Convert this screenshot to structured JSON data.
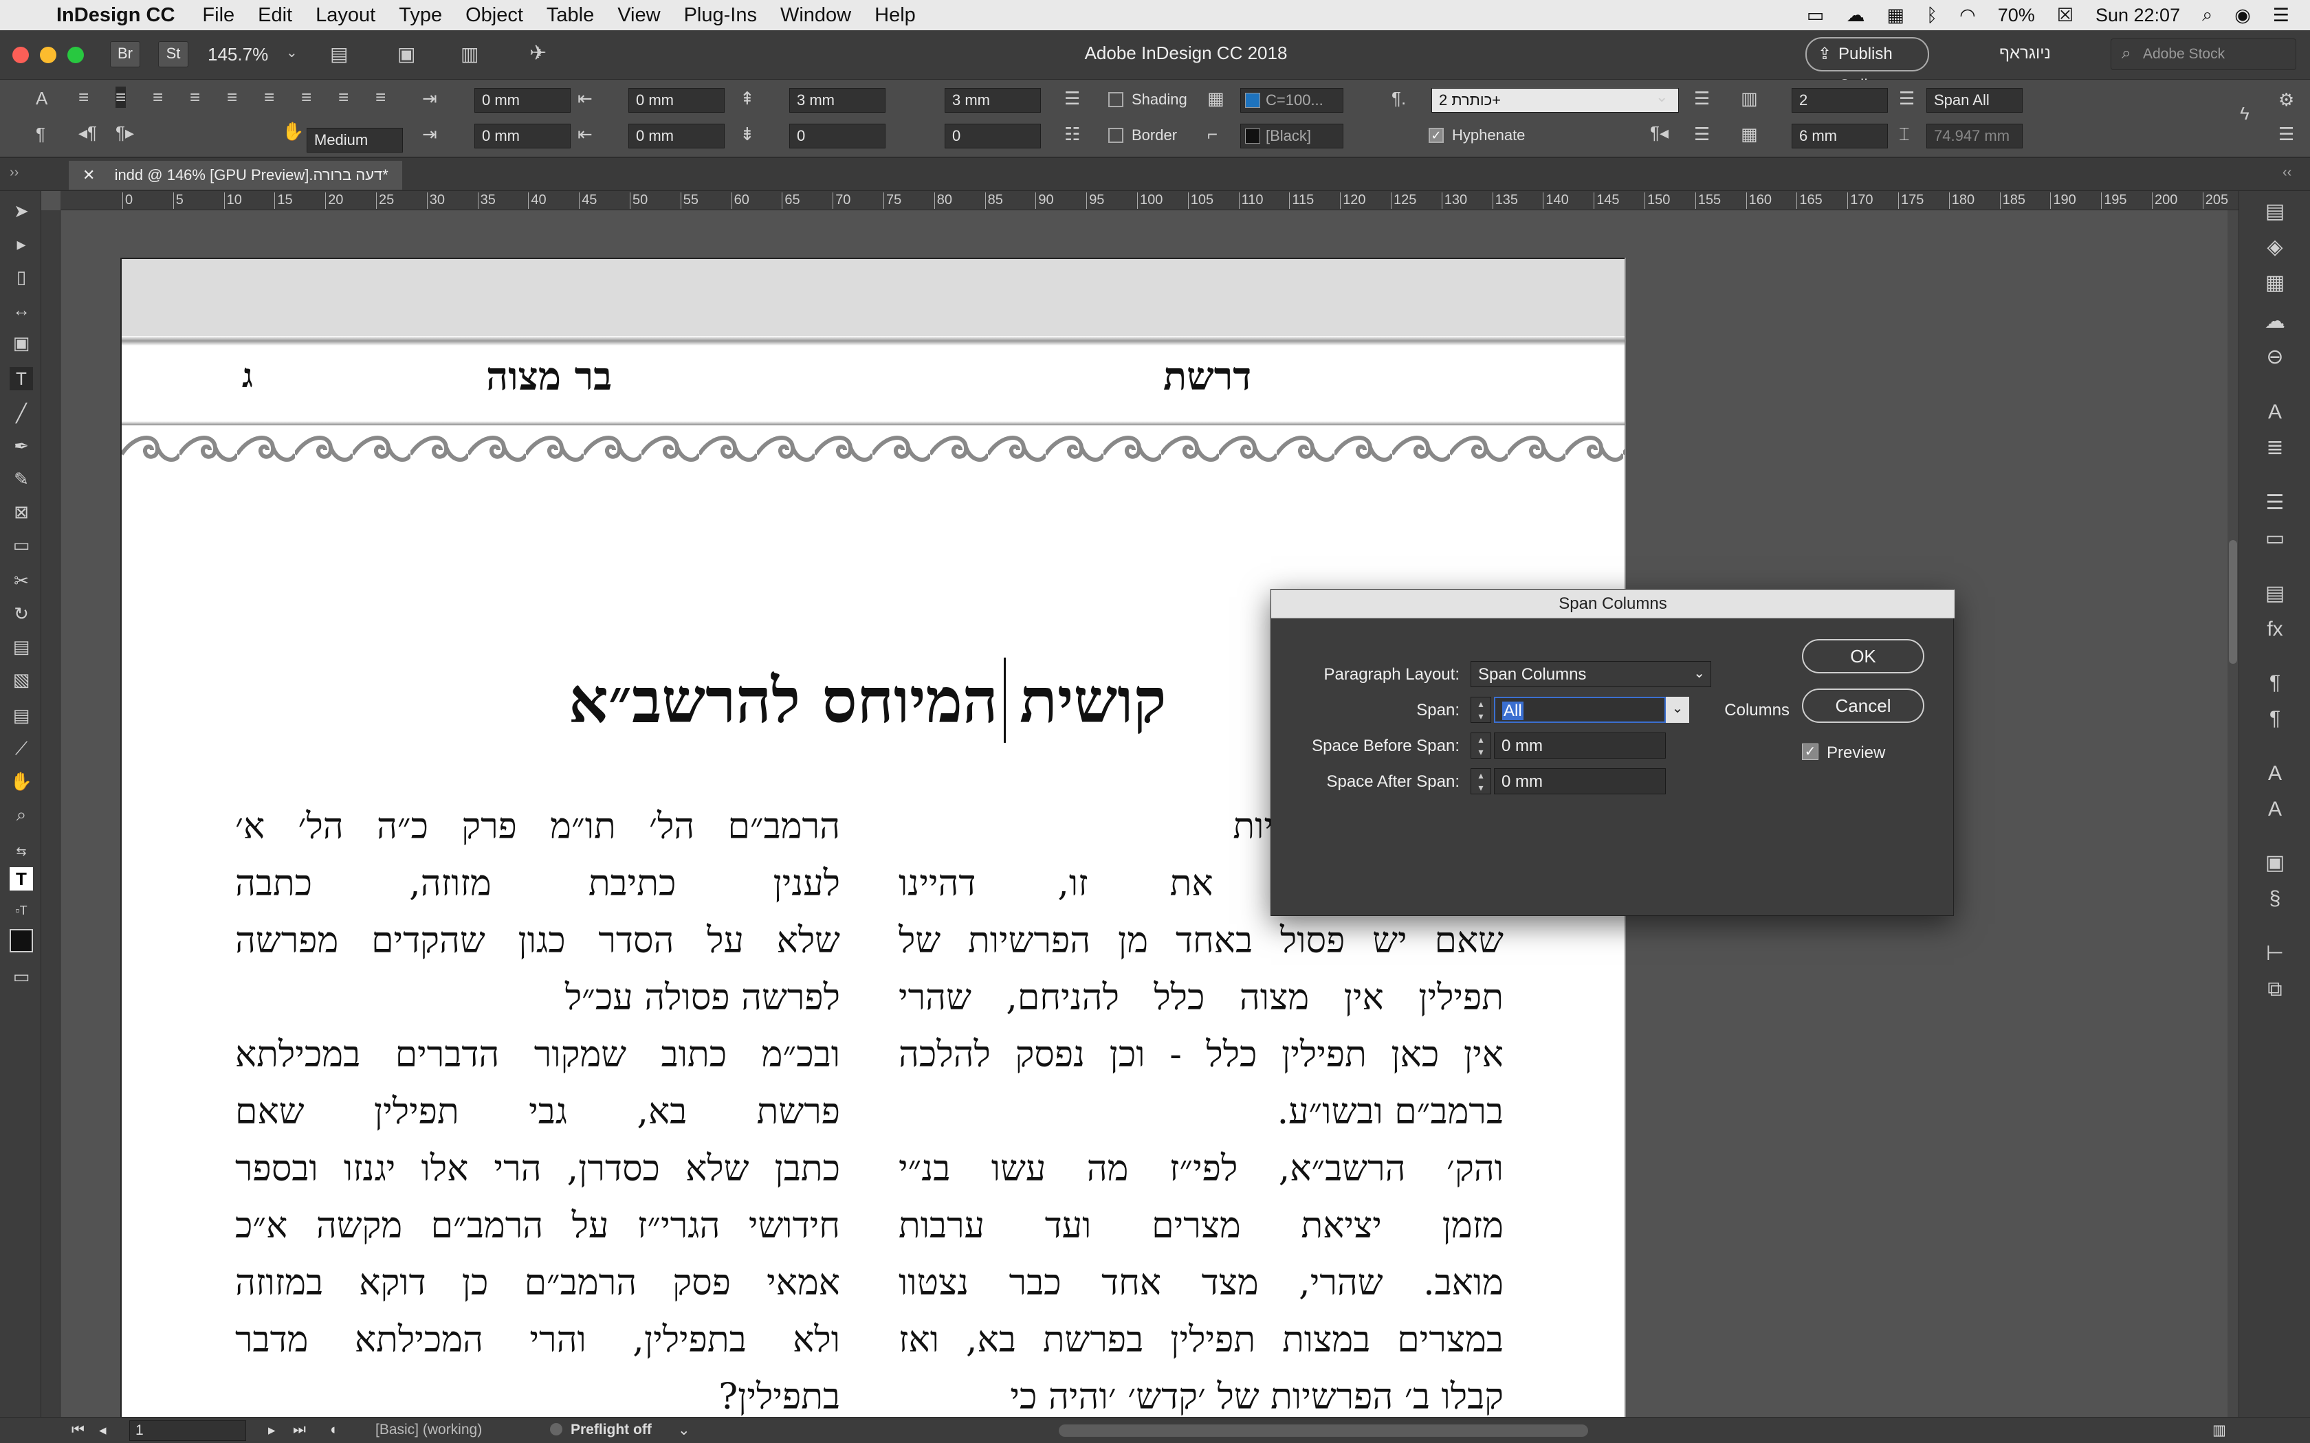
{
  "menubar": {
    "app_name": "InDesign CC",
    "items": [
      "File",
      "Edit",
      "Layout",
      "Type",
      "Object",
      "Table",
      "View",
      "Plug-Ins",
      "Window",
      "Help"
    ],
    "battery": "70%",
    "clock": "Sun 22:07"
  },
  "appbar": {
    "title": "Adobe InDesign CC 2018",
    "zoom": "145.7%",
    "br_label": "Br",
    "st_label": "St",
    "publish_label": "Publish Online",
    "workspace": "ניוגראף",
    "search_placeholder": "Adobe Stock"
  },
  "control": {
    "indent_left": "0 mm",
    "indent_right": "0 mm",
    "first_indent": "0 mm",
    "last_indent": "0 mm",
    "space_before": "3 mm",
    "space_after": "3 mm",
    "drop_cap_lines": "0",
    "drop_cap_chars": "0",
    "shading_label": "Shading",
    "border_label": "Border",
    "shading_color": "C=100...",
    "border_color": "[Black]",
    "para_style": "+כותרת 2",
    "hyphenate_label": "Hyphenate",
    "columns": "2",
    "gutter": "6 mm",
    "span_mode": "Span All",
    "width_value": "74.947 mm",
    "kinsoku": "Medium"
  },
  "tab": {
    "doc_title": "indd @ 146% [GPU Preview].דעה ברורה*"
  },
  "ruler": {
    "ticks": [
      "0",
      "5",
      "10",
      "15",
      "20",
      "25",
      "30",
      "35",
      "40",
      "45",
      "50",
      "55",
      "60",
      "65",
      "70",
      "75",
      "80",
      "85",
      "90",
      "95",
      "100",
      "105",
      "110",
      "115",
      "120",
      "125",
      "130",
      "135",
      "140",
      "145",
      "150",
      "155",
      "160",
      "165",
      "170",
      "175",
      "180",
      "185",
      "190",
      "195",
      "200",
      "205"
    ]
  },
  "page": {
    "header_left_letter": "ג",
    "header_center": "בר מצוה",
    "header_right": "דרשת",
    "headline": "קושית המיוחס להרשב״א",
    "col_right": [
      "דף כח. - ד׳ פרשיות",
      "מעכבים זו את זו, דהיינו",
      "שאם יש פסול באחד מן הפרשיות של",
      "תפילין אין מצוה כלל להניחם, שהרי",
      "אין כאן תפילין כלל - וכן נפסק להלכה",
      "ברמב״ם ובשו״ע.",
      "והק׳ הרשב״א, לפי״ז מה עשו בנ״י",
      "מזמן יציאת מצרים ועד ערבות",
      "מואב. שהרי, מצד אחד כבר נצטוו",
      "במצרים במצות תפילין בפרשת בא, ואז",
      "קבלו ב׳ הפרשיות של ׳קדש׳ ׳והיה כי"
    ],
    "col_left": [
      "הרמב״ם הל׳ תו״מ פרק כ״ה הל׳ א׳",
      "לענין כתיבת מזוזה, כתבה",
      "שלא על הסדר כגון שהקדים מפרשה",
      "לפרשה פסולה עכ״ל",
      "ובכ״מ כתוב שמקור הדברים במכילתא",
      "פרשת בא, גבי תפילין שאם",
      "כתבן שלא כסדרן, הרי אלו יגנזו ובספר",
      "חידושי הגרי״ז על הרמב״ם מקשה א״כ",
      "אמאי פסק הרמב״ם כן דוקא במזוזה",
      "ולא בתפילין, והרי המכילתא מדבר",
      "בתפילין?"
    ]
  },
  "dialog": {
    "title": "Span Columns",
    "paragraph_layout_label": "Paragraph Layout:",
    "paragraph_layout_value": "Span Columns",
    "span_label": "Span:",
    "span_value": "All",
    "span_unit": "Columns",
    "space_before_label": "Space Before Span:",
    "space_before_value": "0 mm",
    "space_after_label": "Space After Span:",
    "space_after_value": "0 mm",
    "ok_label": "OK",
    "cancel_label": "Cancel",
    "preview_label": "Preview",
    "preview_checked": true
  },
  "status": {
    "page_field": "1",
    "style": "[Basic] (working)",
    "preflight": "Preflight off"
  },
  "colors": {
    "shading_swatch": "#1e73be",
    "accent": "#3b6fd0"
  }
}
